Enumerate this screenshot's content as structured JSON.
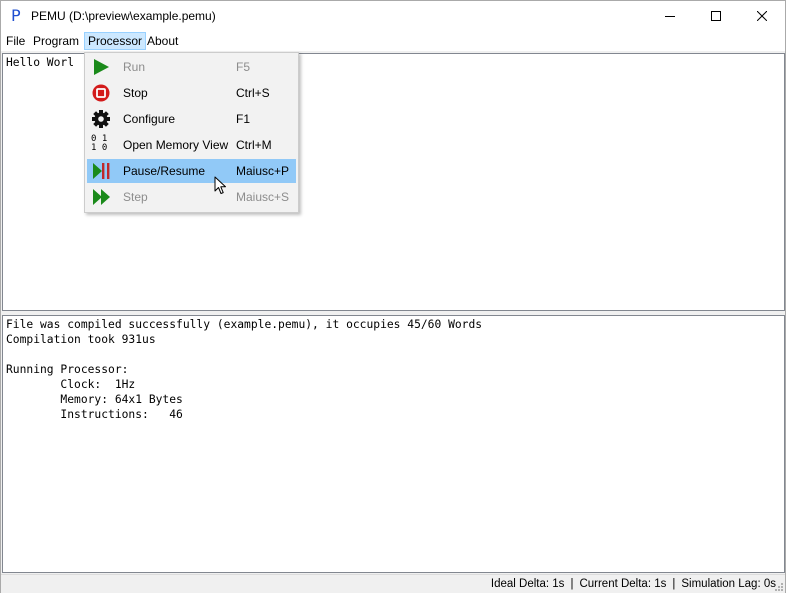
{
  "window": {
    "title": "PEMU (D:\\preview\\example.pemu)",
    "app_icon": "P"
  },
  "menubar": {
    "items": [
      {
        "label": "File"
      },
      {
        "label": "Program"
      },
      {
        "label": "Processor"
      },
      {
        "label": "About"
      }
    ]
  },
  "processor_menu": {
    "items": [
      {
        "label": "Run",
        "shortcut": "F5",
        "icon": "play-icon",
        "enabled": false
      },
      {
        "label": "Stop",
        "shortcut": "Ctrl+S",
        "icon": "stop-icon",
        "enabled": true
      },
      {
        "label": "Configure",
        "shortcut": "F1",
        "icon": "gear-icon",
        "enabled": true
      },
      {
        "label": "Open Memory View",
        "shortcut": "Ctrl+M",
        "icon": "memory-icon",
        "icon_text": "0 1\n1 0",
        "enabled": true
      },
      {
        "label": "Pause/Resume",
        "shortcut": "Maiusc+P",
        "icon": "pause-resume-icon",
        "enabled": true,
        "highlighted": true
      },
      {
        "label": "Step",
        "shortcut": "Maiusc+S",
        "icon": "step-icon",
        "enabled": false
      }
    ]
  },
  "editor": {
    "content": "Hello Worl"
  },
  "console": {
    "content": "File was compiled successfully (example.pemu), it occupies 45/60 Words\nCompilation took 931us\n\nRunning Processor:\n        Clock:  1Hz\n        Memory: 64x1 Bytes\n        Instructions:   46"
  },
  "statusbar": {
    "ideal_delta": "Ideal Delta: 1s",
    "current_delta": "Current Delta: 1s",
    "simulation_lag": "Simulation Lag: 0s",
    "separator": "|"
  },
  "colors": {
    "menu_highlight": "#91c9f7",
    "play_green": "#1a8a1a",
    "stop_red": "#d31b1b",
    "pause_red": "#c0282a"
  }
}
